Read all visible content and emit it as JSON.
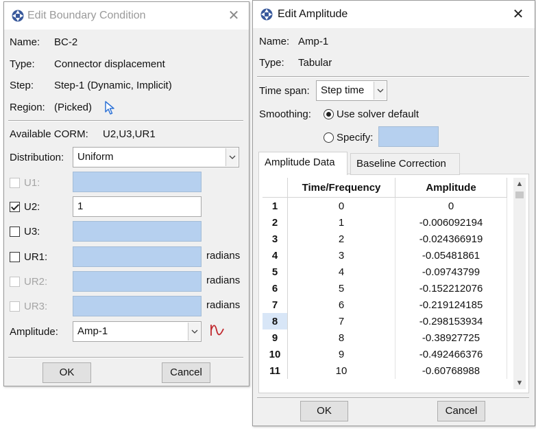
{
  "bc_dialog": {
    "title": "Edit Boundary Condition",
    "name_label": "Name:",
    "name_value": "BC-2",
    "type_label": "Type:",
    "type_value": "Connector displacement",
    "step_label": "Step:",
    "step_value": "Step-1 (Dynamic, Implicit)",
    "region_label": "Region:",
    "region_value": "(Picked)",
    "corm_label": "Available CORM:",
    "corm_value": "U2,U3,UR1",
    "distribution_label": "Distribution:",
    "distribution_value": "Uniform",
    "dofs": [
      {
        "label": "U1:",
        "checked": false,
        "enabled": false,
        "value": "",
        "unit": ""
      },
      {
        "label": "U2:",
        "checked": true,
        "enabled": true,
        "value": "1",
        "unit": ""
      },
      {
        "label": "U3:",
        "checked": false,
        "enabled": true,
        "value": "",
        "unit": ""
      },
      {
        "label": "UR1:",
        "checked": false,
        "enabled": true,
        "value": "",
        "unit": "radians"
      },
      {
        "label": "UR2:",
        "checked": false,
        "enabled": false,
        "value": "",
        "unit": "radians"
      },
      {
        "label": "UR3:",
        "checked": false,
        "enabled": false,
        "value": "",
        "unit": "radians"
      }
    ],
    "amplitude_label": "Amplitude:",
    "amplitude_value": "Amp-1",
    "ok_label": "OK",
    "cancel_label": "Cancel"
  },
  "amp_dialog": {
    "title": "Edit Amplitude",
    "name_label": "Name:",
    "name_value": "Amp-1",
    "type_label": "Type:",
    "type_value": "Tabular",
    "timespan_label": "Time span:",
    "timespan_value": "Step time",
    "smoothing_label": "Smoothing:",
    "smoothing_option1": "Use solver default",
    "smoothing_option2": "Specify:",
    "tabs": [
      "Amplitude Data",
      "Baseline Correction"
    ],
    "columns": [
      "Time/Frequency",
      "Amplitude"
    ],
    "rows": [
      [
        "1",
        "0",
        "0"
      ],
      [
        "2",
        "1",
        "-0.006092194"
      ],
      [
        "3",
        "2",
        "-0.024366919"
      ],
      [
        "4",
        "3",
        "-0.05481861"
      ],
      [
        "5",
        "4",
        "-0.09743799"
      ],
      [
        "6",
        "5",
        "-0.152212076"
      ],
      [
        "7",
        "6",
        "-0.219124185"
      ],
      [
        "8",
        "7",
        "-0.298153934"
      ],
      [
        "9",
        "8",
        "-0.38927725"
      ],
      [
        "10",
        "9",
        "-0.492466376"
      ],
      [
        "11",
        "10",
        "-0.60768988"
      ]
    ],
    "selected_row": "8",
    "ok_label": "OK",
    "cancel_label": "Cancel"
  },
  "colors": {
    "disabled_field": "#b6d0ef",
    "pointer_icon": "#2f73d6",
    "amplitude_icon": "#c0272d",
    "title_icon": "#3a5a9c"
  }
}
